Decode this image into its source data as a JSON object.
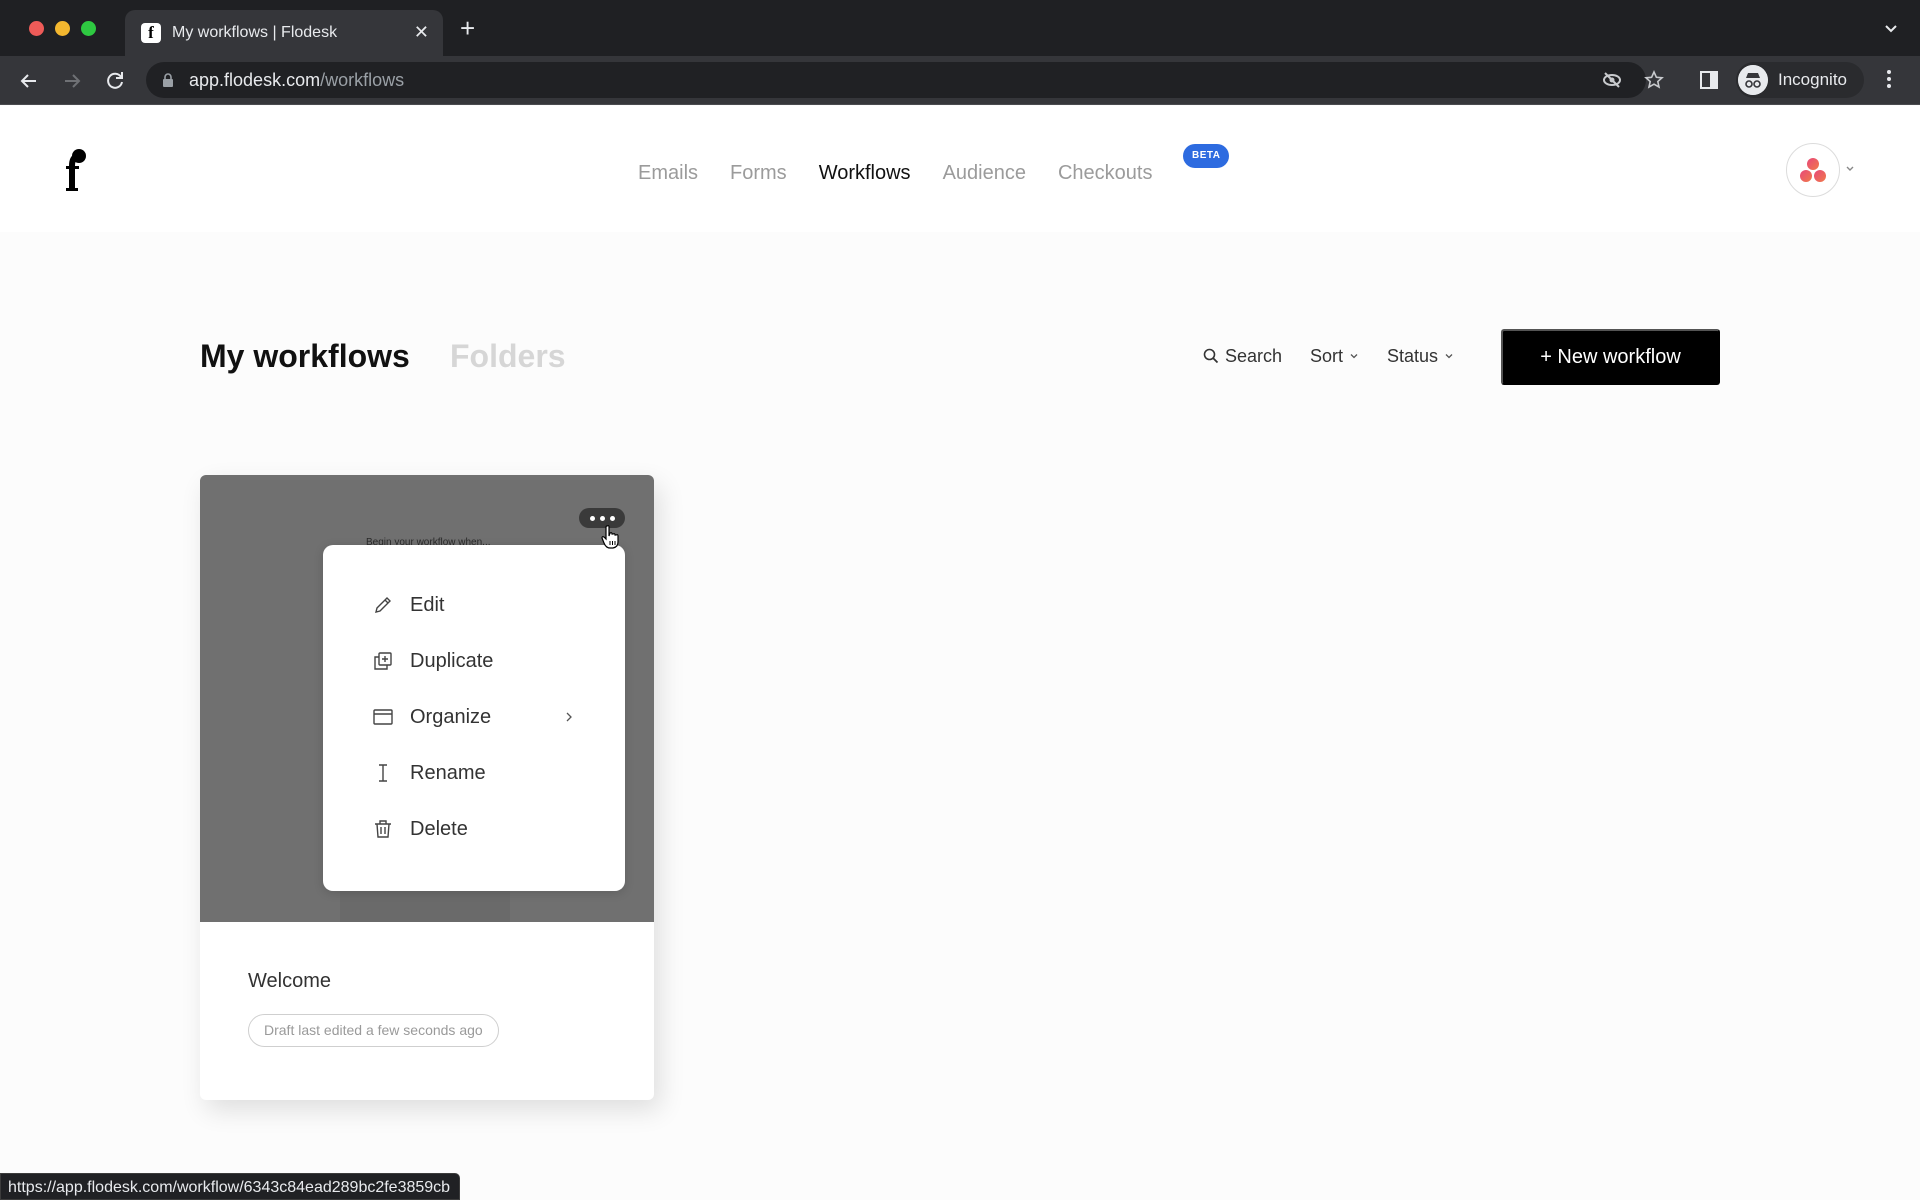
{
  "browser": {
    "tab_title": "My workflows | Flodesk",
    "url_host": "app.flodesk.com",
    "url_path": "/workflows",
    "profile_label": "Incognito",
    "status_url": "https://app.flodesk.com/workflow/6343c84ead289bc2fe3859cb"
  },
  "app": {
    "logo_icon": "flodesk-logo",
    "nav": [
      {
        "label": "Emails",
        "active": false
      },
      {
        "label": "Forms",
        "active": false
      },
      {
        "label": "Workflows",
        "active": true
      },
      {
        "label": "Audience",
        "active": false
      },
      {
        "label": "Checkouts",
        "active": false,
        "badge": "BETA"
      }
    ],
    "accent_color": "#2d6be0"
  },
  "page": {
    "title": "My workflows",
    "secondary_tab": "Folders",
    "search_label": "Search",
    "sort_label": "Sort",
    "status_label": "Status",
    "new_button_label": "+ New workflow"
  },
  "workflows": [
    {
      "name": "Welcome",
      "status": "Draft last edited a few seconds ago",
      "preview_text": "Begin your workflow when..."
    }
  ],
  "context_menu": {
    "items": [
      {
        "label": "Edit",
        "icon": "pencil-icon"
      },
      {
        "label": "Duplicate",
        "icon": "duplicate-icon"
      },
      {
        "label": "Organize",
        "icon": "folder-icon",
        "submenu": true
      },
      {
        "label": "Rename",
        "icon": "text-cursor-icon"
      },
      {
        "label": "Delete",
        "icon": "trash-icon"
      }
    ]
  }
}
